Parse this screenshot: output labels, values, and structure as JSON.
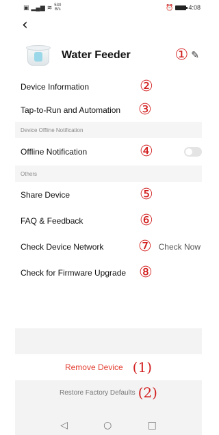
{
  "status_bar": {
    "left_icons": [
      "sim-icon",
      "signal-icon",
      "wifi-icon"
    ],
    "speed_value": "530",
    "speed_unit": "B/s",
    "time": "4:08"
  },
  "header": {
    "title": "Water Feeder",
    "annotation": "①"
  },
  "menu": {
    "device_info": {
      "label": "Device Information",
      "annotation": "②"
    },
    "tap_to_run": {
      "label": "Tap-to-Run and Automation",
      "annotation": "③"
    },
    "offline_section": "Device Offline Notification",
    "offline_notification": {
      "label": "Offline Notification",
      "annotation": "④",
      "enabled": false
    },
    "others_section": "Others",
    "share_device": {
      "label": "Share Device",
      "annotation": "⑤"
    },
    "faq": {
      "label": "FAQ & Feedback",
      "annotation": "⑥"
    },
    "check_network": {
      "label": "Check Device Network",
      "annotation": "⑦",
      "action": "Check Now"
    },
    "firmware": {
      "label": "Check for Firmware Upgrade",
      "annotation": "⑧"
    }
  },
  "actions": {
    "remove_device": "Remove Device",
    "remove_annotation": "(1)",
    "restore_defaults": "Restore Factory Defaults",
    "restore_annotation": "(2)"
  },
  "nav": {
    "back": "◁",
    "home": "○",
    "recents": "□"
  },
  "colors": {
    "remove": "#e23b2e",
    "annotation": "#d32020",
    "section_bg": "#f5f5f5"
  }
}
